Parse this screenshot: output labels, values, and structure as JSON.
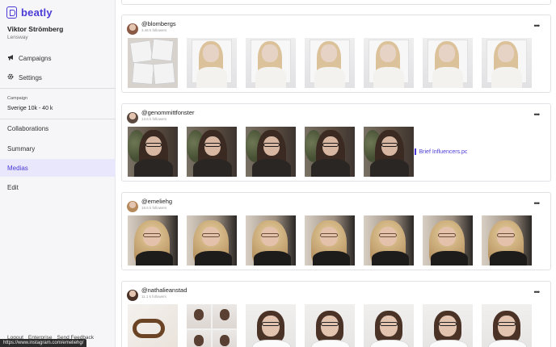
{
  "app": {
    "brand": "beatly",
    "brand_color": "#4b3bd6"
  },
  "user": {
    "name": "Viktor Strömberg",
    "company": "Lensway"
  },
  "nav_top": [
    {
      "label": "Campaigns",
      "icon": "megaphone-icon"
    },
    {
      "label": "Settings",
      "icon": "gear-icon"
    }
  ],
  "campaign": {
    "label": "Campaign",
    "name": "Sverige 10k - 40 k"
  },
  "nav_campaign": [
    {
      "label": "Collaborations",
      "active": false
    },
    {
      "label": "Summary",
      "active": false
    },
    {
      "label": "Medias",
      "active": true
    },
    {
      "label": "Edit",
      "active": false
    }
  ],
  "footer": {
    "logout": "Logout",
    "enterprise": "Enterprise",
    "feedback": "Send Feedback"
  },
  "status_url": "https://www.instagram.com/emeliehg/",
  "influencers": [
    {
      "handle": "@blombergs",
      "followers": "3.46 k followers",
      "avatar_color": "#8a5a44",
      "photos": [
        "wall-grid",
        "wall",
        "wall",
        "wall",
        "wall",
        "wall",
        "wall"
      ]
    },
    {
      "handle": "@genommittfonster",
      "followers": "13.6 k followers",
      "avatar_color": "#5b4a40",
      "photos": [
        "dark",
        "dark",
        "dark",
        "dark",
        "dark"
      ],
      "brief_link": "Brief Influencers.pc"
    },
    {
      "handle": "@emeliehg",
      "followers": "18.6 k followers",
      "avatar_color": "#b58a5a",
      "photos": [
        "blonde",
        "blonde",
        "blonde",
        "blonde",
        "blonde",
        "blonde",
        "blonde"
      ]
    },
    {
      "handle": "@nathalieanstad",
      "followers": "11.1 k followers",
      "avatar_color": "#4a3226",
      "photos": [
        "glasses",
        "grid",
        "light",
        "light",
        "light",
        "light",
        "light"
      ]
    }
  ],
  "more_label": "•••"
}
